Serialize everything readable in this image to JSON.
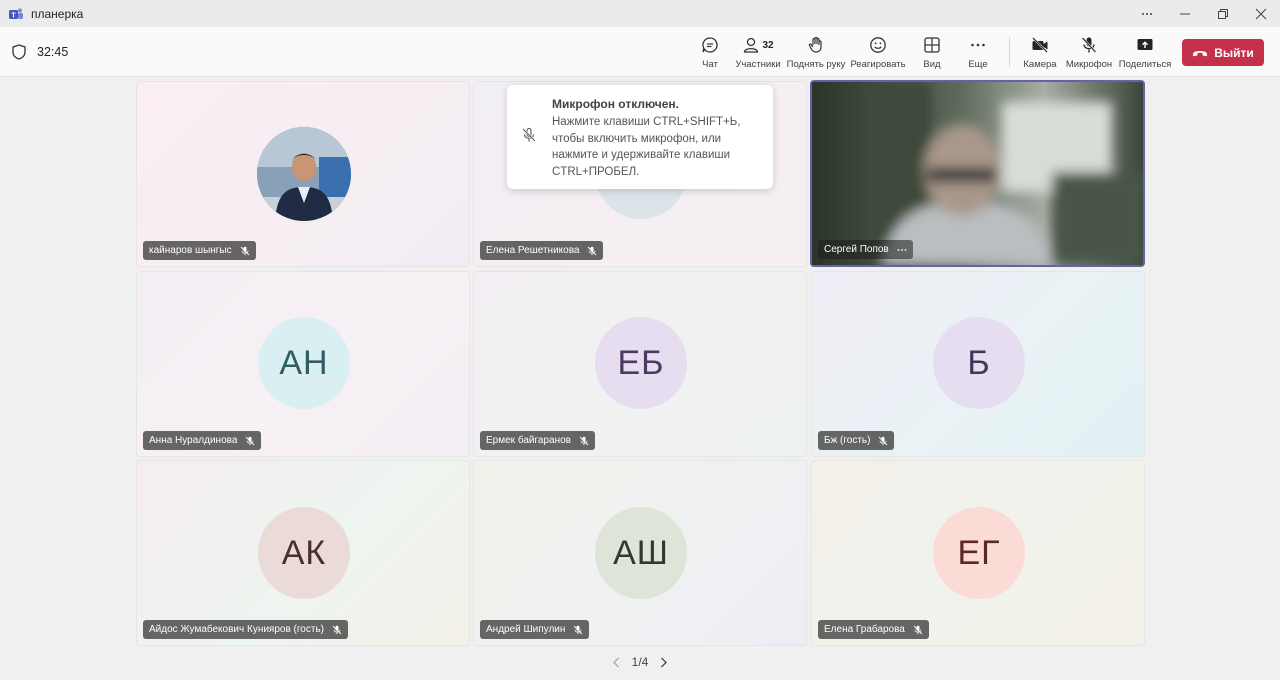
{
  "window": {
    "title": "планерка"
  },
  "toolbar": {
    "timer": "32:45",
    "chat": "Чат",
    "participants": "Участники",
    "participants_count": "32",
    "raise_hand": "Поднять руку",
    "react": "Реагировать",
    "view": "Вид",
    "more": "Еще",
    "camera": "Камера",
    "microphone": "Микрофон",
    "share": "Поделиться",
    "leave": "Выйти"
  },
  "toast": {
    "title": "Микрофон отключен.",
    "body": "Нажмите клавиши CTRL+SHIFT+Ь, чтобы включить микрофон, или нажмите и удерживайте клавиши CTRL+ПРОБЕЛ."
  },
  "participants": [
    {
      "name": "кайнаров шынгыс",
      "initials": "",
      "muted": true
    },
    {
      "name": "Елена Решетникова",
      "initials": "",
      "muted": true
    },
    {
      "name": "Сергей Попов",
      "initials": "",
      "muted": false
    },
    {
      "name": "Анна Нуралдинова",
      "initials": "АН",
      "muted": true
    },
    {
      "name": "Ермек байгаранов",
      "initials": "ЕБ",
      "muted": true
    },
    {
      "name": "Бж (гость)",
      "initials": "Б",
      "muted": true
    },
    {
      "name": "Айдос Жумабекович Кунияров (гость)",
      "initials": "АК",
      "muted": true
    },
    {
      "name": "Андрей Шипулин",
      "initials": "АШ",
      "muted": true
    },
    {
      "name": "Елена Грабарова",
      "initials": "ЕГ",
      "muted": true
    }
  ],
  "pagination": {
    "label": "1/4"
  },
  "colors": {
    "leave": "#c4314b",
    "active_speaker_border": "#6264a7"
  }
}
